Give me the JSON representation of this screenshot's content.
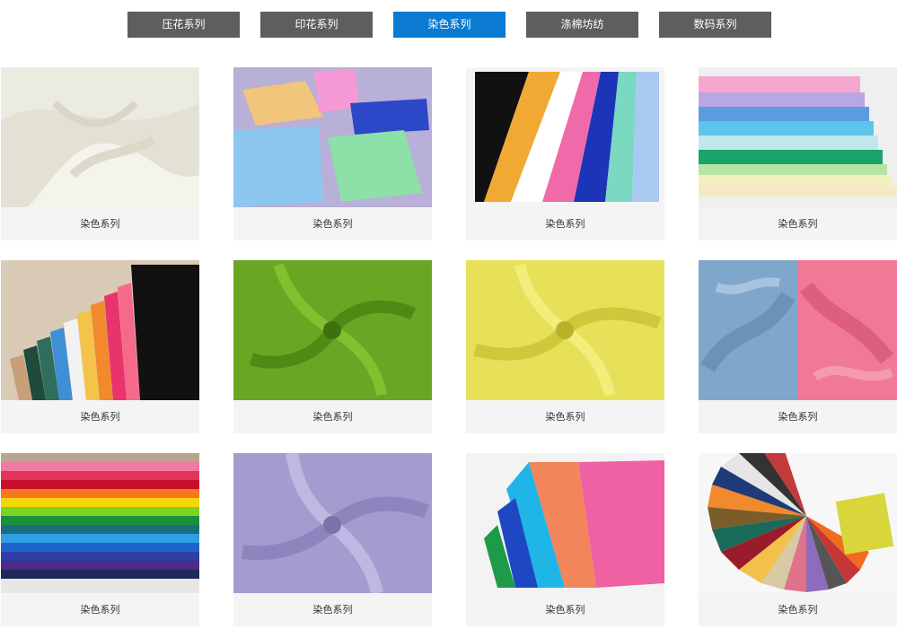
{
  "tabs": [
    {
      "label": "压花系列",
      "active": false
    },
    {
      "label": "印花系列",
      "active": false
    },
    {
      "label": "染色系列",
      "active": true
    },
    {
      "label": "涤棉坊纺",
      "active": false
    },
    {
      "label": "数码系列",
      "active": false
    }
  ],
  "products": [
    {
      "caption": "染色系列"
    },
    {
      "caption": "染色系列"
    },
    {
      "caption": "染色系列"
    },
    {
      "caption": "染色系列"
    },
    {
      "caption": "染色系列"
    },
    {
      "caption": "染色系列"
    },
    {
      "caption": "染色系列"
    },
    {
      "caption": "染色系列"
    },
    {
      "caption": "染色系列"
    },
    {
      "caption": "染色系列"
    },
    {
      "caption": "染色系列"
    },
    {
      "caption": "染色系列"
    }
  ],
  "colors": {
    "tab_bg": "#5e5e5e",
    "tab_active_bg": "#0b7bd1",
    "caption_bg": "#f4f4f4"
  }
}
